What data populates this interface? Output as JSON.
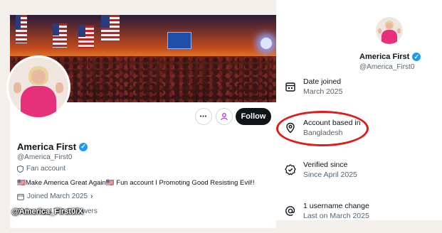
{
  "profile": {
    "display_name": "America First",
    "handle": "@America_First0",
    "fan_account_label": "Fan account",
    "bio": "🇺🇸Make America Great Again🇺🇸 Fun account I Promoting Good Resisting Evil!!",
    "joined": "Joined March 2025",
    "follow_stats": "Following   1761 Followers",
    "follow_button_label": "Follow",
    "more_button_label": "•••",
    "verified_mark": "✓"
  },
  "about_panel": {
    "display_name": "America First",
    "handle": "@America_First0",
    "rows": [
      {
        "title": "Date joined",
        "value": "March 2025",
        "icon": "calendar-icon"
      },
      {
        "title": "Account based in",
        "value": "Bangladesh",
        "icon": "location-pin-icon"
      },
      {
        "title": "Verified since",
        "value": "Since April 2025",
        "icon": "verified-check-icon"
      },
      {
        "title": "1 username change",
        "value": "Last on March 2025",
        "icon": "at-sign-icon"
      }
    ]
  },
  "watermark": "@America_First0/X",
  "colors": {
    "verified_blue": "#1d9bf0",
    "highlight_red": "#e01b1b",
    "follow_button": "#0f1419",
    "dress_pink": "#e6307a"
  }
}
